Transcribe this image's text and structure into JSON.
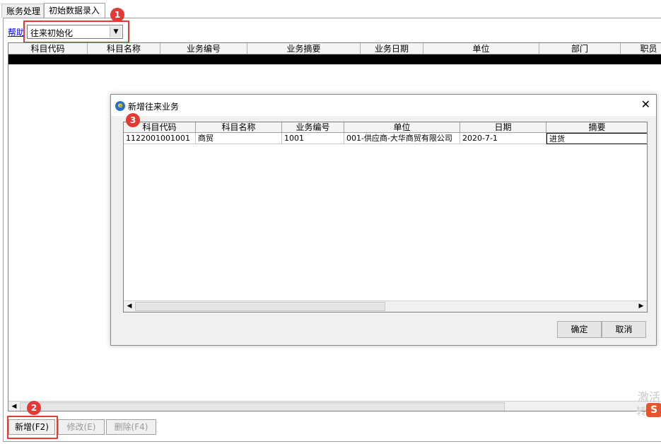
{
  "tabs": [
    {
      "label": "账务处理"
    },
    {
      "label": "初始数据录入"
    }
  ],
  "help_link": "帮助",
  "combo": {
    "value": "往来初始化"
  },
  "badges": [
    "1",
    "2",
    "3"
  ],
  "main_table": {
    "columns": [
      "科目代码",
      "科目名称",
      "业务编号",
      "业务摘要",
      "业务日期",
      "单位",
      "部门",
      "职员"
    ]
  },
  "bottom_buttons": {
    "add": "新增(F2)",
    "edit": "修改(E)",
    "delete": "删除(F4)"
  },
  "dialog": {
    "title": "新增往来业务",
    "columns": [
      "科目代码",
      "科目名称",
      "业务编号",
      "单位",
      "日期",
      "摘要"
    ],
    "rows": [
      [
        "1122001001001",
        "商贸",
        "1001",
        "001-供应商-大华商贸有限公司",
        "2020-7-1",
        "进货"
      ]
    ],
    "ok": "确定",
    "cancel": "取消",
    "close": "✕"
  },
  "watermark": {
    "line1": "激活",
    "line2": "转",
    "logo": "S"
  }
}
